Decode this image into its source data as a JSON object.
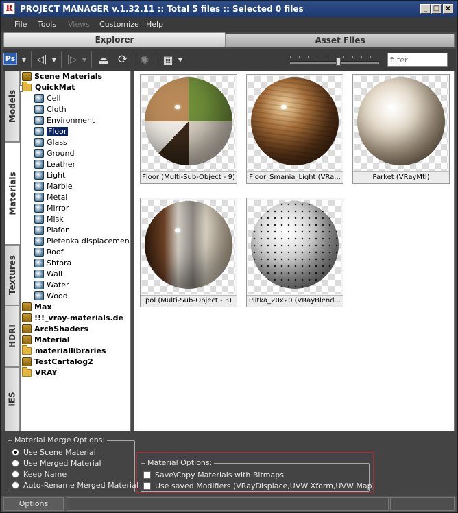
{
  "window": {
    "logo": "R",
    "title": "PROJECT MANAGER v.1.32.11   :: Total 5 files  :: Selected 0 files"
  },
  "menu": [
    {
      "label": "File",
      "enabled": true
    },
    {
      "label": "Tools",
      "enabled": true
    },
    {
      "label": "Views",
      "enabled": false
    },
    {
      "label": "Customize",
      "enabled": true
    },
    {
      "label": "Help",
      "enabled": true
    }
  ],
  "tabs": {
    "explorer": "Explorer",
    "asset_files": "Asset Files"
  },
  "toolbar": {
    "ps_badge": "Ps",
    "filter_placeholder": "filter"
  },
  "side_tabs": [
    "Models",
    "Materials",
    "Textures",
    "HDRI",
    "IES"
  ],
  "tree": [
    {
      "label": "Scene Materials",
      "kind": "mlib",
      "bold": true,
      "level": 0
    },
    {
      "label": "QuickMat",
      "kind": "folder",
      "bold": true,
      "level": 0
    },
    {
      "label": "Cell",
      "kind": "mat",
      "level": 1
    },
    {
      "label": "Cloth",
      "kind": "mat",
      "level": 1
    },
    {
      "label": "Environment",
      "kind": "mat",
      "level": 1
    },
    {
      "label": "Floor",
      "kind": "mat",
      "level": 1,
      "selected": true
    },
    {
      "label": "Glass",
      "kind": "mat",
      "level": 1
    },
    {
      "label": "Ground",
      "kind": "mat",
      "level": 1
    },
    {
      "label": "Leather",
      "kind": "mat",
      "level": 1
    },
    {
      "label": "Light",
      "kind": "mat",
      "level": 1
    },
    {
      "label": "Marble",
      "kind": "mat",
      "level": 1
    },
    {
      "label": "Metal",
      "kind": "mat",
      "level": 1
    },
    {
      "label": "Mirror",
      "kind": "mat",
      "level": 1
    },
    {
      "label": "Misk",
      "kind": "mat",
      "level": 1
    },
    {
      "label": "Plafon",
      "kind": "mat",
      "level": 1
    },
    {
      "label": "Pletenka displacement",
      "kind": "mat",
      "level": 1
    },
    {
      "label": "Roof",
      "kind": "mat",
      "level": 1
    },
    {
      "label": "Shtora",
      "kind": "mat",
      "level": 1
    },
    {
      "label": "Wall",
      "kind": "mat",
      "level": 1
    },
    {
      "label": "Water",
      "kind": "mat",
      "level": 1
    },
    {
      "label": "Wood",
      "kind": "mat",
      "level": 1
    },
    {
      "label": "Max",
      "kind": "mlib",
      "bold": true,
      "level": 0
    },
    {
      "label": "!!!_vray-materials.de",
      "kind": "mlib",
      "bold": true,
      "level": 0
    },
    {
      "label": "ArchShaders",
      "kind": "mlib",
      "bold": true,
      "level": 0
    },
    {
      "label": "Material",
      "kind": "mlib",
      "bold": true,
      "level": 0
    },
    {
      "label": "materiallibraries",
      "kind": "folder",
      "bold": true,
      "level": 0
    },
    {
      "label": "TestCartalog2",
      "kind": "mlib",
      "bold": true,
      "level": 0
    },
    {
      "label": "VRAY",
      "kind": "folder",
      "bold": true,
      "level": 0
    }
  ],
  "thumbnails": [
    {
      "caption": "Floor (Multi-Sub-Object - 9)",
      "style": "multi"
    },
    {
      "caption": "Floor_Smania_Light (VRa...",
      "style": "wood"
    },
    {
      "caption": "Parket (VRayMtl)",
      "style": "cream"
    },
    {
      "caption": "pol (Multi-Sub-Object - 3)",
      "style": "pol"
    },
    {
      "caption": "Plitka_20x20 (VRayBlend...",
      "style": "dots"
    }
  ],
  "merge_options": {
    "title": "Material Merge Options:",
    "options": [
      {
        "label": "Use Scene Material",
        "selected": true
      },
      {
        "label": "Use Merged Material",
        "selected": false
      },
      {
        "label": "Keep Name",
        "selected": false
      },
      {
        "label": "Auto-Rename Merged Material",
        "selected": false
      }
    ]
  },
  "material_options": {
    "title": "Material Options:",
    "checks": [
      {
        "label": "Save\\Copy Materials with Bitmaps",
        "checked": false
      },
      {
        "label": "Use saved Modifiers (VRayDisplace,UVW Xform,UVW Map)",
        "checked": false
      }
    ]
  },
  "status": {
    "options_button": "Options"
  },
  "colors": {
    "title_bar": "#1e3a72",
    "selection": "#0a246a",
    "highlight_box": "#c0222a"
  }
}
